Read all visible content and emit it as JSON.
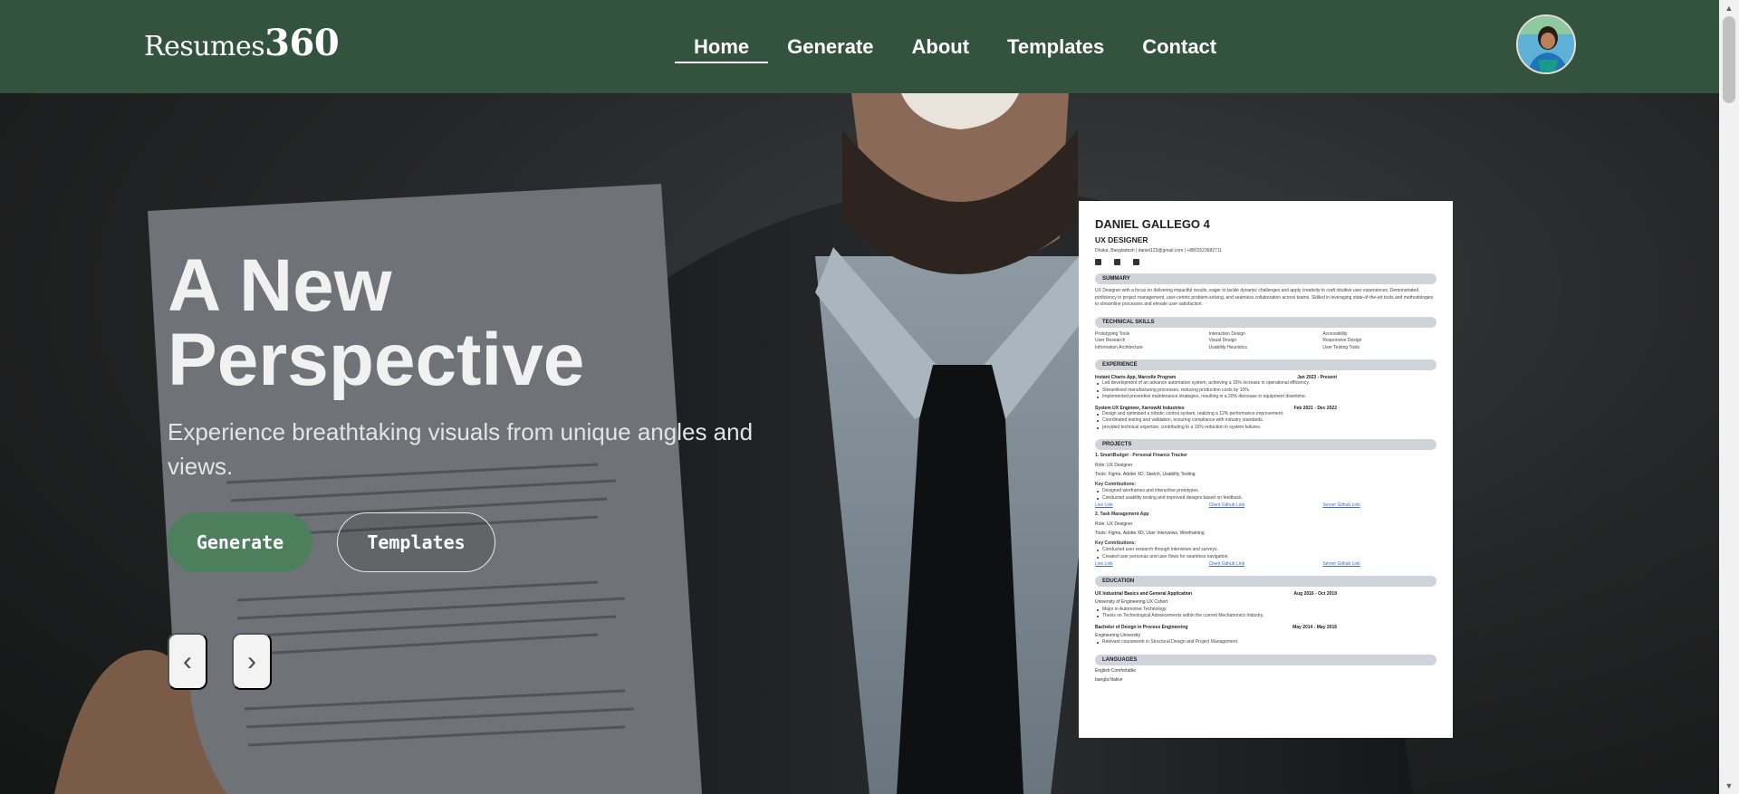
{
  "brand": {
    "name": "Resumes",
    "number": "360"
  },
  "nav": {
    "items": [
      {
        "label": "Home",
        "active": true
      },
      {
        "label": "Generate",
        "active": false
      },
      {
        "label": "About",
        "active": false
      },
      {
        "label": "Templates",
        "active": false
      },
      {
        "label": "Contact",
        "active": false
      }
    ]
  },
  "hero": {
    "title_line1": "A New",
    "title_line2": "Perspective",
    "subtitle": "Experience breathtaking visuals from unique angles and views.",
    "generate_label": "Generate",
    "templates_label": "Templates",
    "prev_label": "‹",
    "next_label": "›"
  },
  "resume": {
    "name": "DANIEL GALLEGO 4",
    "title": "UX DESIGNER",
    "contact": "Dhaka, Bangladesh | daniel123@gmail.com | +8801523682711",
    "sections": {
      "summary": "SUMMARY",
      "skills": "TECHNICAL SKILLS",
      "experience": "EXPERIENCE",
      "projects": "PROJECTS",
      "education": "EDUCATION",
      "languages": "LANGUAGES"
    },
    "summary_text": "UX Designer with a focus on delivering impactful results, eager to tackle dynamic challenges and apply creativity to craft intuitive user experiences. Demonstrated proficiency in project management, user-centric problem-solving, and seamless collaboration across teams. Skilled in leveraging state-of-the-art tools and methodologies to streamline processes and elevate user satisfaction.",
    "skills": [
      "Prototyping Tools",
      "Interaction Design",
      "Accessibility",
      "User Research",
      "Visual Design",
      "Responsive Design",
      "Information Architecture",
      "Usability Heuristics",
      "User Testing Tools"
    ],
    "exp1_title": "Instant Charts App, Marcelle Program",
    "exp1_date": "Jan 2023 - Present",
    "exp1_bullets": [
      "Led development of an advance automation system, achieving a 15% increase in operational efficiency.",
      "Streamlined manufacturing processes, reducing production costs by 10%.",
      "Implemented preventive maintenance strategies, resulting in a 20% decrease in equipment downtime."
    ],
    "exp2_title": "System UX Engineer, XarrowAI Industries",
    "exp2_date": "Feb 2021 - Dec 2022",
    "exp2_bullets": [
      "Design and optimised a robotic control system, realizing a 12% performance improvement.",
      "Coordinated testing and validation, ensuring compliance with industry standards.",
      "provided technical expertise, contributing to a 15% reduction in system failures."
    ],
    "proj1_title": "1. SmartBudget - Personal Finance Tracker",
    "proj1_role": "Role: UX Designer",
    "proj1_tools": "Tools: Figma, Adobe XD, Sketch, Usability Testing",
    "proj1_key": "Key Contributions:",
    "proj1_bullets": [
      "Designed wireframes and interactive prototypes.",
      "Conducted usability testing and improved designs based on feedback."
    ],
    "proj2_title": "2. Task Management App",
    "proj2_role": "Role: UX Designer",
    "proj2_tools": "Tools: Figma, Adobe XD, User Interviews, Wireframing",
    "proj2_key": "Key Contributions:",
    "proj2_bullets": [
      "Conducted user research through interviews and surveys.",
      "Created user personas and user flows for seamless navigation."
    ],
    "links": [
      "Live Link",
      "Client Github Link",
      "Server Github Link"
    ],
    "edu1_title": "UX Industrial Basics and General Application",
    "edu1_date": "Aug 2016 - Oct 2019",
    "edu1_school": "University of Engineering UX Cohort",
    "edu1_bullets": [
      "Major in Automotive Technology.",
      "Thesis on Technological Advancements within the current Mechatronics Industry."
    ],
    "edu2_title": "Bachelor of Design in Process Engineering",
    "edu2_date": "May 2014 - May 2016",
    "edu2_school": "Engineering University",
    "edu2_bullets": [
      "Relevant coursework in Structural Design and Project Management."
    ],
    "lang1": "English:Comfortable",
    "lang2": "bangla:Native"
  },
  "icons": [
    "chevron-up-icon",
    "chevron-down-icon",
    "linkedin-icon",
    "github-icon",
    "facebook-icon"
  ]
}
